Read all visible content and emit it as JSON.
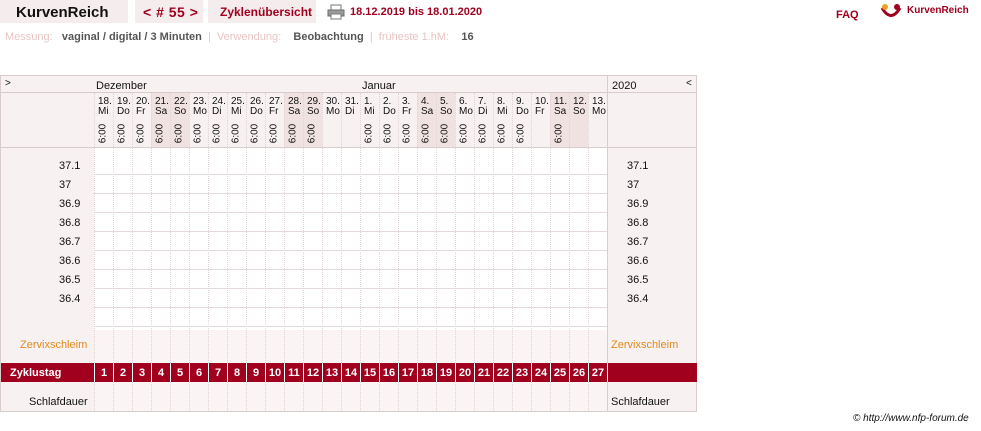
{
  "header": {
    "title": "KurvenReich",
    "nav": "< # 55 >",
    "overview": "Zyklenübersicht",
    "date_range": "18.12.2019 bis 18.01.2020",
    "faq": "FAQ",
    "logo_text": "KurvenReich"
  },
  "info": {
    "messung_label": "Messung:",
    "messung_value": "vaginal / digital / 3 Minuten",
    "verwendung_label": "Verwendung:",
    "verwendung_value": "Beobachtung",
    "hm_label": "früheste 1.hM:",
    "hm_value": "16",
    "sep": "|"
  },
  "chart": {
    "nav_left": ">",
    "nav_right": "<",
    "month1": "Dezember",
    "month2": "Januar",
    "year": "2020",
    "days": [
      {
        "n": "18.",
        "w": "Mi",
        "t": "6:00",
        "we": false
      },
      {
        "n": "19.",
        "w": "Do",
        "t": "6:00",
        "we": false
      },
      {
        "n": "20.",
        "w": "Fr",
        "t": "6:00",
        "we": false
      },
      {
        "n": "21.",
        "w": "Sa",
        "t": "6:00",
        "we": true
      },
      {
        "n": "22.",
        "w": "So",
        "t": "6:00",
        "we": true
      },
      {
        "n": "23.",
        "w": "Mo",
        "t": "6:00",
        "we": false
      },
      {
        "n": "24.",
        "w": "Di",
        "t": "6:00",
        "we": false
      },
      {
        "n": "25.",
        "w": "Mi",
        "t": "6:00",
        "we": false
      },
      {
        "n": "26.",
        "w": "Do",
        "t": "6:00",
        "we": false
      },
      {
        "n": "27.",
        "w": "Fr",
        "t": "6:00",
        "we": false
      },
      {
        "n": "28.",
        "w": "Sa",
        "t": "6:00",
        "we": true
      },
      {
        "n": "29.",
        "w": "So",
        "t": "6:00",
        "we": true
      },
      {
        "n": "30.",
        "w": "Mo",
        "t": "",
        "we": false
      },
      {
        "n": "31.",
        "w": "Di",
        "t": "",
        "we": false
      },
      {
        "n": "1.",
        "w": "Mi",
        "t": "6:00",
        "we": false
      },
      {
        "n": "2.",
        "w": "Do",
        "t": "6:00",
        "we": false
      },
      {
        "n": "3.",
        "w": "Fr",
        "t": "6:00",
        "we": false
      },
      {
        "n": "4.",
        "w": "Sa",
        "t": "6:00",
        "we": true
      },
      {
        "n": "5.",
        "w": "So",
        "t": "6:00",
        "we": true
      },
      {
        "n": "6.",
        "w": "Mo",
        "t": "6:00",
        "we": false
      },
      {
        "n": "7.",
        "w": "Di",
        "t": "6:00",
        "we": false
      },
      {
        "n": "8.",
        "w": "Mi",
        "t": "6:00",
        "we": false
      },
      {
        "n": "9.",
        "w": "Do",
        "t": "6:00",
        "we": false
      },
      {
        "n": "10.",
        "w": "Fr",
        "t": "",
        "we": false
      },
      {
        "n": "11.",
        "w": "Sa",
        "t": "6:00",
        "we": true
      },
      {
        "n": "12.",
        "w": "So",
        "t": "",
        "we": true
      },
      {
        "n": "13.",
        "w": "Mo",
        "t": "",
        "we": false
      }
    ],
    "y_labels": [
      "37.1",
      "37",
      "36.9",
      "36.8",
      "36.7",
      "36.6",
      "36.5",
      "36.4"
    ],
    "zervix": "Zervixschleim",
    "zyklustag": "Zyklustag",
    "cycle_days": [
      "1",
      "2",
      "3",
      "4",
      "5",
      "6",
      "7",
      "8",
      "9",
      "10",
      "11",
      "12",
      "13",
      "14",
      "15",
      "16",
      "17",
      "18",
      "19",
      "20",
      "21",
      "22",
      "23",
      "24",
      "25",
      "26",
      "27"
    ],
    "schlafdauer": "Schlafdauer"
  },
  "footer": {
    "copyright": "© http://www.nfp-forum.de"
  },
  "colors": {
    "accent": "#a0001e",
    "orange": "#e08a1e",
    "weekend": "#f1e2e2"
  }
}
